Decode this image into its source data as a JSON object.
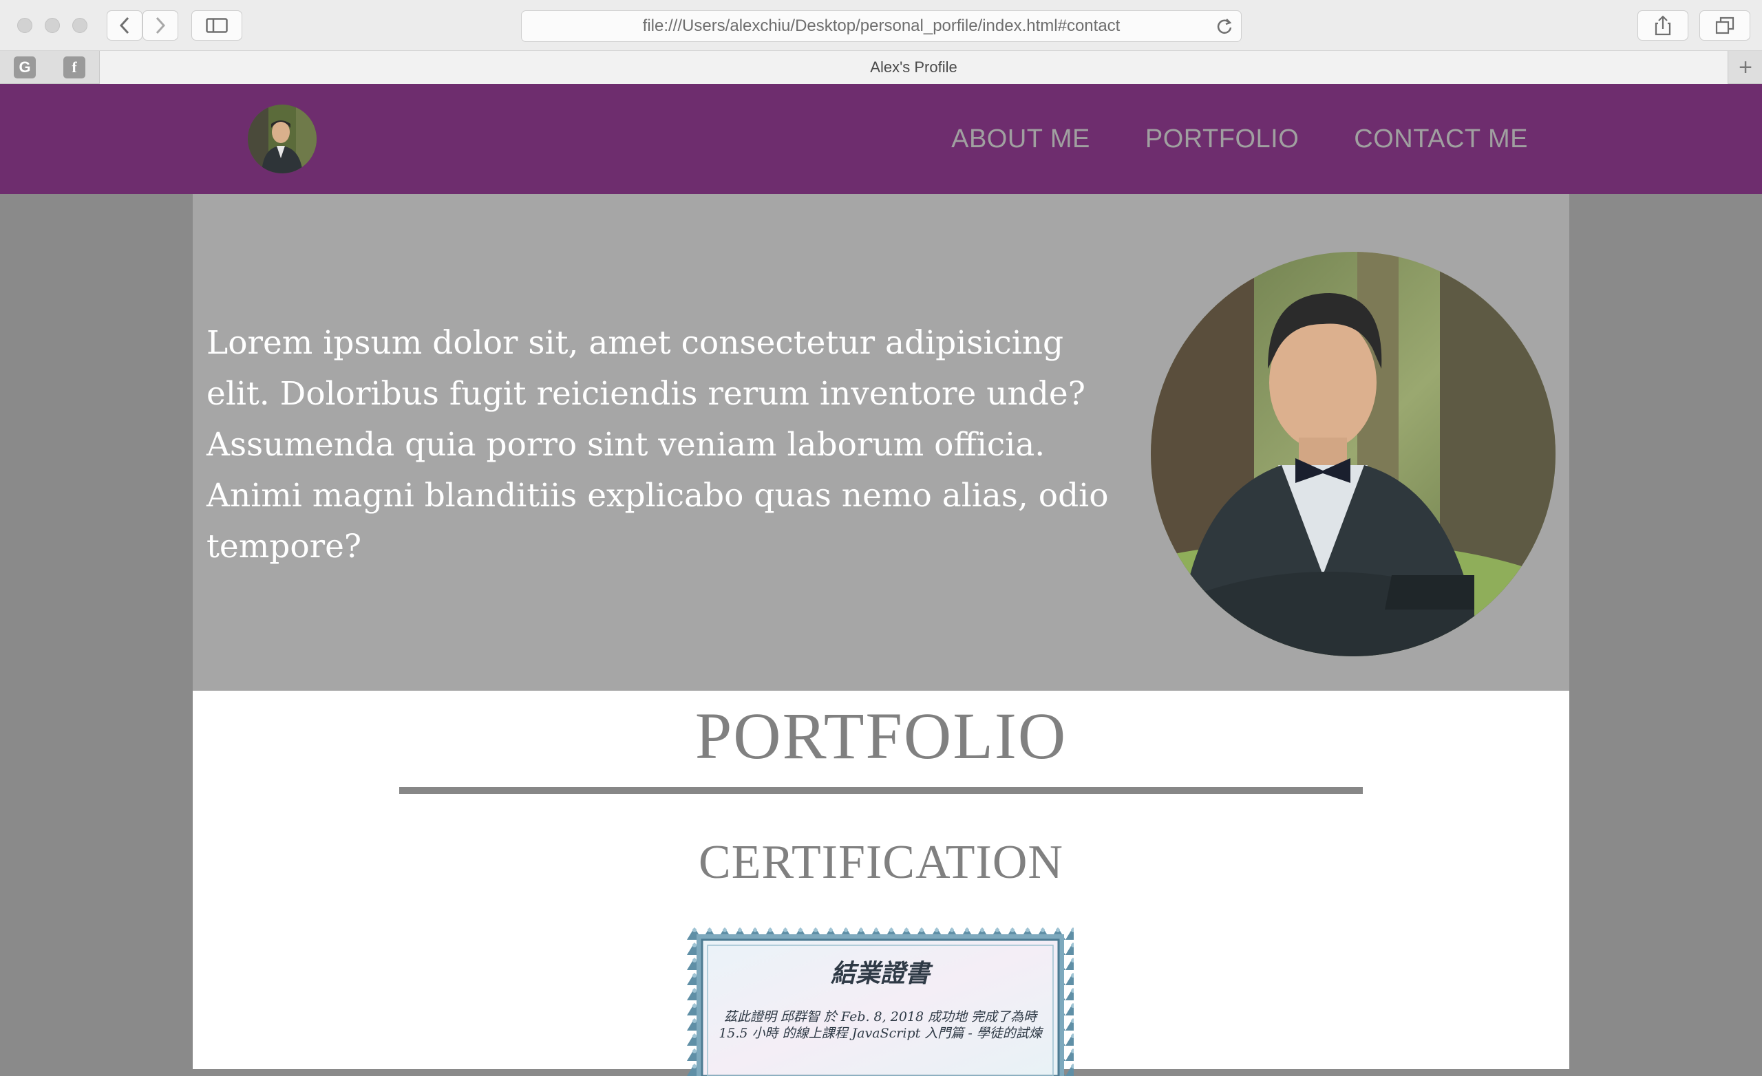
{
  "browser": {
    "url": "file:///Users/alexchiu/Desktop/personal_porfile/index.html#contact",
    "tab_title": "Alex's Profile",
    "favicons": [
      "G",
      "f"
    ]
  },
  "nav": {
    "about": "ABOUT ME",
    "portfolio": "PORTFOLIO",
    "contact": "CONTACT ME"
  },
  "hero": {
    "text": "Lorem ipsum dolor sit, amet consectetur adipisicing elit. Doloribus fugit reiciendis rerum inventore unde? Assumenda quia porro sint veniam laborum officia. Animi magni blanditiis explicabo quas nemo alias, odio tempore?"
  },
  "portfolio": {
    "title": "PORTFOLIO",
    "certification_title": "CERTIFICATION",
    "certificate": {
      "heading": "結業證書",
      "body": "茲此證明 邱群智 於 Feb. 8, 2018 成功地 完成了為時 15.5 小時 的線上課程 JavaScript 入門篇 - 學徒的試煉"
    }
  },
  "colors": {
    "header": "#6e2d6e",
    "hero_bg": "#a6a6a6",
    "page_bg": "#8a8a8a",
    "nav_text": "#a0a0a0",
    "heading_text": "#808080"
  }
}
